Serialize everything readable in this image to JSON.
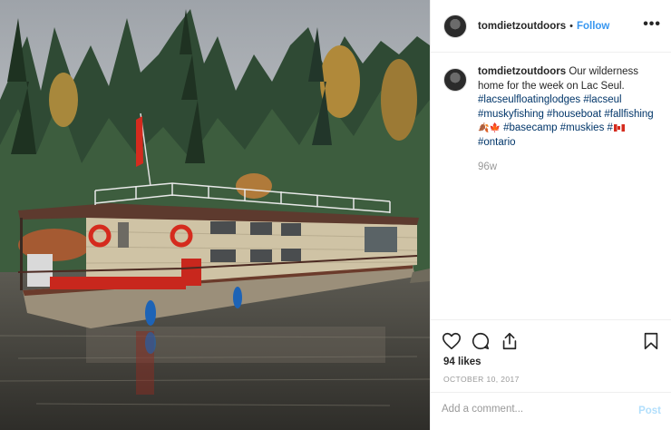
{
  "post": {
    "username": "tomdietzoutdoors",
    "separator": "•",
    "follow_label": "Follow",
    "more_label": "•••"
  },
  "caption": {
    "username": "tomdietzoutdoors",
    "text": "Our wilderness home for the week on Lac Seul.",
    "hashtags_line1": "#lacseulfloatinglodges #lacseul",
    "hashtags_line2": "#muskyfishing #houseboat #fallfishing",
    "emoji_leaves": "🍂🍁",
    "hashtags_line3": "#basecamp #muskies #",
    "hashtags_line4": "#ontario",
    "relative_time": "96w"
  },
  "engagement": {
    "likes": "94 likes",
    "date": "OCTOBER 10, 2017"
  },
  "comment": {
    "placeholder": "Add a comment...",
    "post_label": "Post"
  },
  "icons": {
    "like": "heart-icon",
    "comment": "comment-icon",
    "share": "share-icon",
    "save": "bookmark-icon",
    "flag": "canada-flag-icon"
  },
  "colors": {
    "link": "#3897f0",
    "hashtag": "#003569",
    "muted": "#999999",
    "post_disabled": "#b2dffc"
  }
}
